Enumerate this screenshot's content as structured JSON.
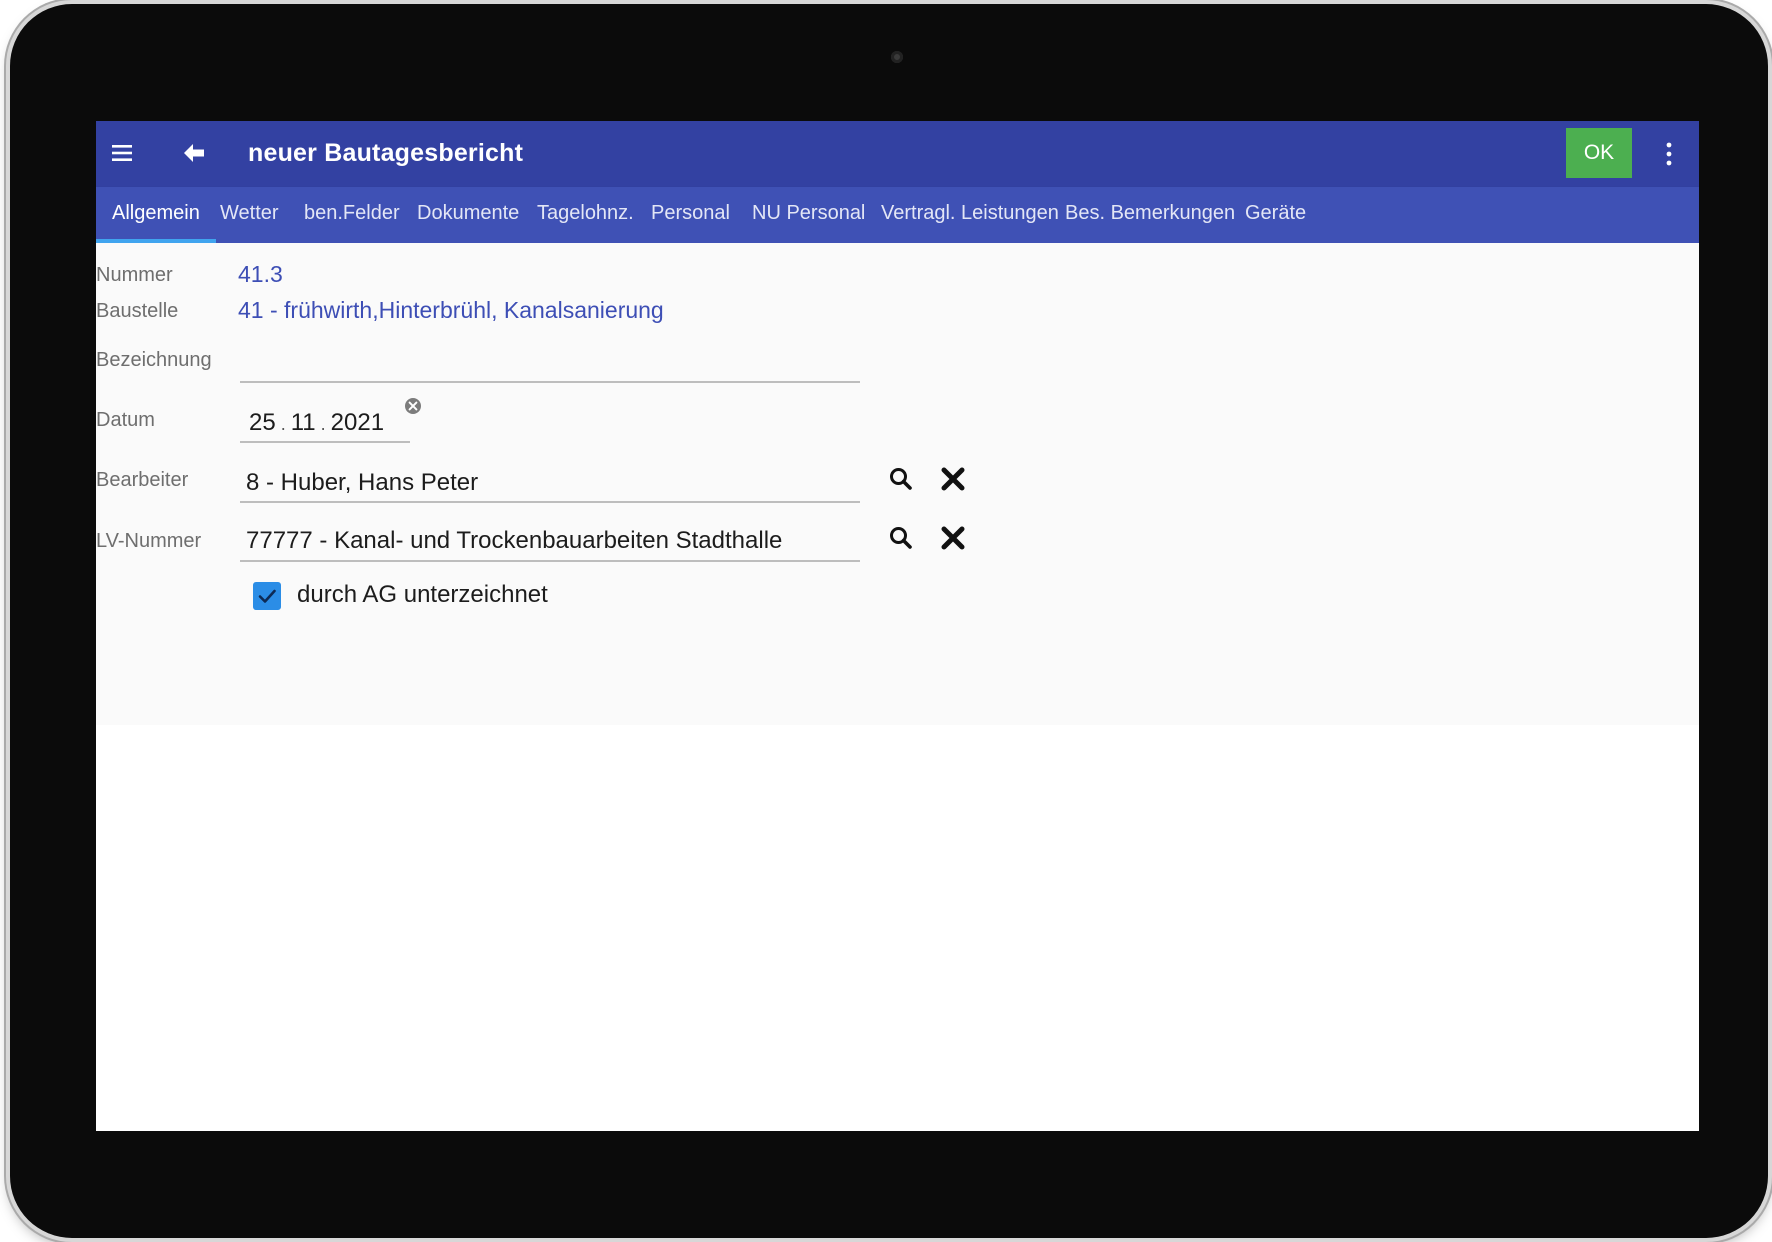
{
  "app": {
    "title": "neuer Bautagesbericht",
    "ok_label": "OK"
  },
  "tabs": [
    {
      "label": "Allgemein",
      "active": true
    },
    {
      "label": "Wetter"
    },
    {
      "label": "ben.Felder"
    },
    {
      "label": "Dokumente"
    },
    {
      "label": "Tagelohnz."
    },
    {
      "label": "Personal"
    },
    {
      "label": "NU Personal"
    },
    {
      "label": "Vertragl. Leistungen"
    },
    {
      "label": "Bes. Bemerkungen"
    },
    {
      "label": "Geräte"
    }
  ],
  "form": {
    "nummer_label": "Nummer",
    "nummer_value": "41.3",
    "baustelle_label": "Baustelle",
    "baustelle_value": "41 - frühwirth,Hinterbrühl, Kanalsanierung",
    "bezeichnung_label": "Bezeichnung",
    "bezeichnung_value": "",
    "datum_label": "Datum",
    "datum_day": "25",
    "datum_month": "11",
    "datum_year": "2021",
    "datum_sep": ".",
    "bearbeiter_label": "Bearbeiter",
    "bearbeiter_value": "8 - Huber, Hans Peter",
    "lv_label": "LV-Nummer",
    "lv_value": "77777 - Kanal- und Trockenbauarbeiten Stadthalle",
    "signed_label": "durch AG unterzeichnet",
    "signed_checked": true
  },
  "colors": {
    "toolbar": "#3341a2",
    "tabs": "#3f51b5",
    "tab_indicator": "#40a4ef",
    "ok_button": "#4caf50",
    "link_value": "#3d4eb5",
    "checkbox": "#2b8de6"
  }
}
